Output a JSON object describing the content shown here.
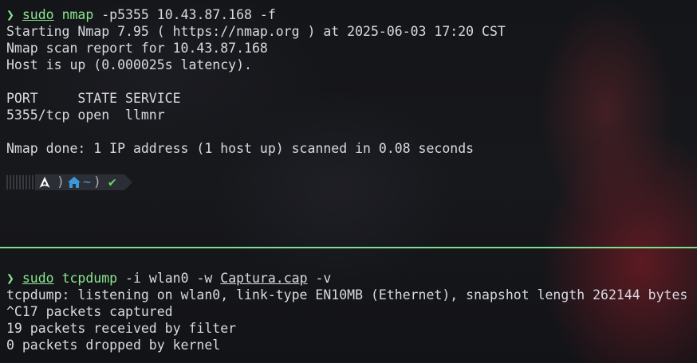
{
  "top_pane": {
    "prompt_symbol": "❯",
    "command": {
      "sudo": "sudo",
      "program": "nmap",
      "args": "-p5355 10.43.87.168 -f"
    },
    "output": [
      "Starting Nmap 7.95 ( https://nmap.org ) at 2025-06-03 17:20 CST",
      "Nmap scan report for 10.43.87.168",
      "Host is up (0.000025s latency).",
      "",
      "PORT     STATE SERVICE",
      "5355/tcp open  llmnr",
      "",
      "Nmap done: 1 IP address (1 host up) scanned in 0.08 seconds",
      ""
    ],
    "powerline": {
      "os_icon": "arch-linux-icon",
      "home_icon": "home-icon",
      "directory": "~",
      "status_icon": "check-icon",
      "status_glyph": "✔",
      "separator": ")"
    }
  },
  "bottom_pane": {
    "prompt_symbol": "❯",
    "command": {
      "sudo": "sudo",
      "program": "tcpdump",
      "args_before_file": "-i wlan0 -w",
      "file": "Captura.cap",
      "args_after_file": "-v"
    },
    "output": [
      "tcpdump: listening on wlan0, link-type EN10MB (Ethernet), snapshot length 262144 bytes",
      "^C17 packets captured",
      "19 packets received by filter",
      "0 packets dropped by kernel"
    ]
  },
  "colors": {
    "divider": "#7ddf8a",
    "prompt": "#8be58f",
    "text": "#d7dbe0",
    "home_icon": "#3a9ad9",
    "check": "#6bd16b"
  }
}
